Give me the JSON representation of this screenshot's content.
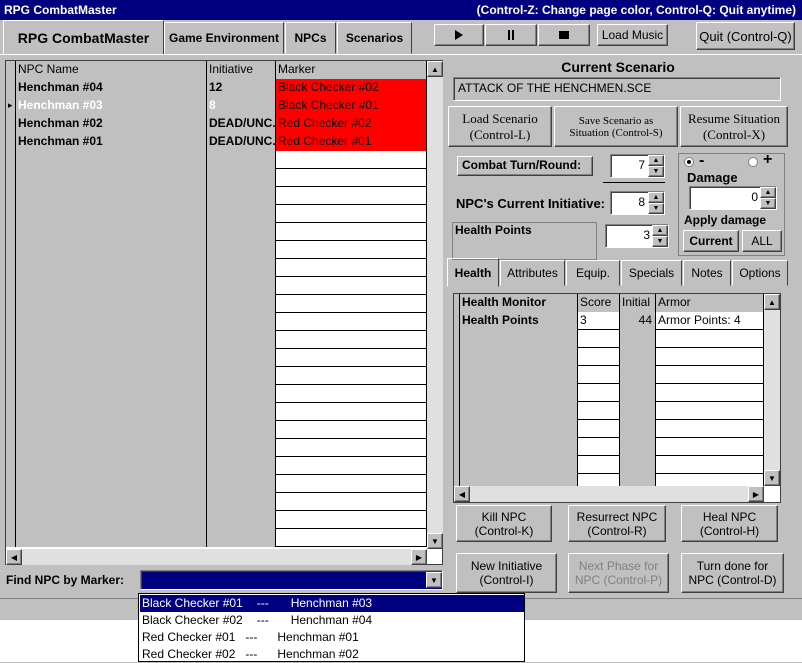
{
  "window": {
    "title": "RPG CombatMaster",
    "hint": "(Control-Z: Change page color, Control-Q: Quit anytime)"
  },
  "tabs": [
    {
      "label": "RPG CombatMaster",
      "active": true
    },
    {
      "label": "Game Environment"
    },
    {
      "label": "NPCs"
    },
    {
      "label": "Scenarios"
    }
  ],
  "media": {
    "play_icon": "play-icon",
    "pause_icon": "pause-icon",
    "stop_icon": "stop-icon",
    "load_music": "Load Music",
    "quit": "Quit (Control-Q)"
  },
  "npc_grid": {
    "columns": [
      "NPC Name",
      "Initiative",
      "Marker"
    ],
    "rows": [
      {
        "name": "Henchman #04",
        "initiative": "12",
        "marker": "Black Checker #02"
      },
      {
        "name": "Henchman #03",
        "initiative": "8",
        "marker": "Black Checker #01",
        "selected": true
      },
      {
        "name": "Henchman #02",
        "initiative": "DEAD/UNC.",
        "marker": "Red Checker #02"
      },
      {
        "name": "Henchman #01",
        "initiative": "DEAD/UNC.",
        "marker": "Red Checker #01"
      }
    ],
    "marker_color": "#ff0000"
  },
  "find": {
    "label": "Find NPC by Marker:",
    "options": [
      {
        "marker": "Black Checker #01",
        "sep": "---",
        "npc": "Henchman #03",
        "highlight": true
      },
      {
        "marker": "Black Checker #02",
        "sep": "---",
        "npc": "Henchman #04"
      },
      {
        "marker": "Red Checker #01",
        "sep": "---",
        "npc": "Henchman #01"
      },
      {
        "marker": "Red Checker #02",
        "sep": "---",
        "npc": "Henchman #02"
      }
    ]
  },
  "scenario": {
    "heading": "Current Scenario",
    "name": "ATTACK OF THE HENCHMEN.SCE",
    "load": [
      "Load Scenario",
      "(Control-L)"
    ],
    "save": [
      "Save Scenario as",
      "Situation (Control-S)"
    ],
    "resume": [
      "Resume Situation",
      "(Control-X)"
    ]
  },
  "combat": {
    "turn_label": "Combat Turn/Round:",
    "turn_value": "7",
    "initiative_label": "NPC's Current Initiative:",
    "initiative_value": "8",
    "health_label": "Health Points",
    "health_value": "3"
  },
  "damage": {
    "minus": "-",
    "plus": "+",
    "label": "Damage",
    "value": "0",
    "apply_label": "Apply damage to:",
    "current": "Current",
    "all": "ALL"
  },
  "detail_tabs": [
    {
      "label": "Health",
      "active": true
    },
    {
      "label": "Attributes"
    },
    {
      "label": "Equip."
    },
    {
      "label": "Specials"
    },
    {
      "label": "Notes"
    },
    {
      "label": "Options"
    }
  ],
  "health_monitor": {
    "columns": [
      "Health Monitor",
      "Score",
      "Initial",
      "Armor"
    ],
    "rows": [
      {
        "name": "Health Points",
        "score": "3",
        "initial": "44",
        "armor": "Armor Points: 4"
      }
    ]
  },
  "actions": {
    "kill": [
      "Kill NPC",
      "(Control-K)"
    ],
    "resurrect": [
      "Resurrect NPC",
      "(Control-R)"
    ],
    "heal": [
      "Heal NPC",
      "(Control-H)"
    ],
    "new_initiative": [
      "New Initiative",
      "(Control-I)"
    ],
    "next_phase": [
      "Next Phase for",
      "NPC (Control-P)"
    ],
    "turn_done": [
      "Turn done for",
      "NPC (Control-D)"
    ]
  }
}
